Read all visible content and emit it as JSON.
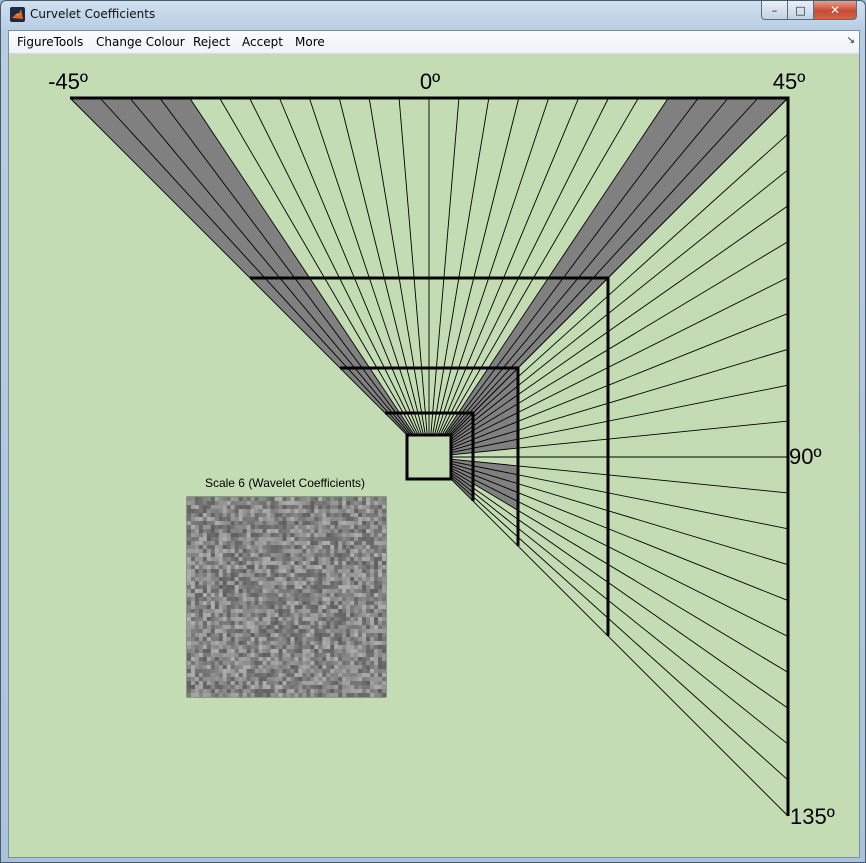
{
  "window": {
    "title": "Curvelet Coefficients",
    "controls": {
      "minimize": "–",
      "maximize": "□",
      "close": "✕"
    }
  },
  "menu": {
    "items": [
      "FigureTools",
      "Change Colour",
      "Reject",
      "Accept",
      "More"
    ],
    "overflow_icon": "double-chevron-icon"
  },
  "figure": {
    "angle_labels": [
      "-45º",
      "0º",
      "45º",
      "90º",
      "135º"
    ],
    "panel_title": "Scale 6 (Wavelet Coefficients)",
    "background_color": "#c4dcb4",
    "rejected_color": "#808080",
    "line_color": "#000000",
    "rejected_wedges": [
      {
        "side": "top",
        "from": 0,
        "to": 4,
        "scales": "all"
      },
      {
        "side": "top",
        "from": 20,
        "to": 24,
        "scales": "all"
      },
      {
        "side": "right",
        "from": 0,
        "to": 9,
        "scales": [
          1,
          2
        ]
      },
      {
        "side": "right",
        "from": 11,
        "to": 13,
        "scales": [
          1,
          2
        ]
      },
      {
        "side": "right",
        "from": 13,
        "to": 16,
        "scales": [
          1,
          2
        ]
      },
      {
        "side": "right",
        "from": 16,
        "to": 20,
        "scales": [
          1
        ]
      }
    ]
  }
}
